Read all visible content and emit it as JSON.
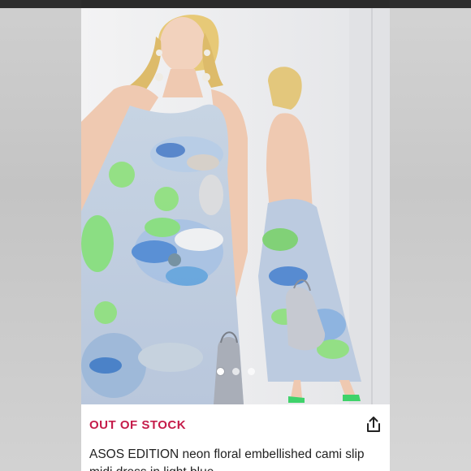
{
  "listing": {
    "status": "OUT OF STOCK",
    "title": "ASOS EDITION neon floral embellished cami slip midi dress in light blue",
    "status_color": "#c51c4a"
  },
  "photo": {
    "carousel_total": 3,
    "carousel_active": 1
  },
  "icons": {
    "share": "share-icon"
  }
}
